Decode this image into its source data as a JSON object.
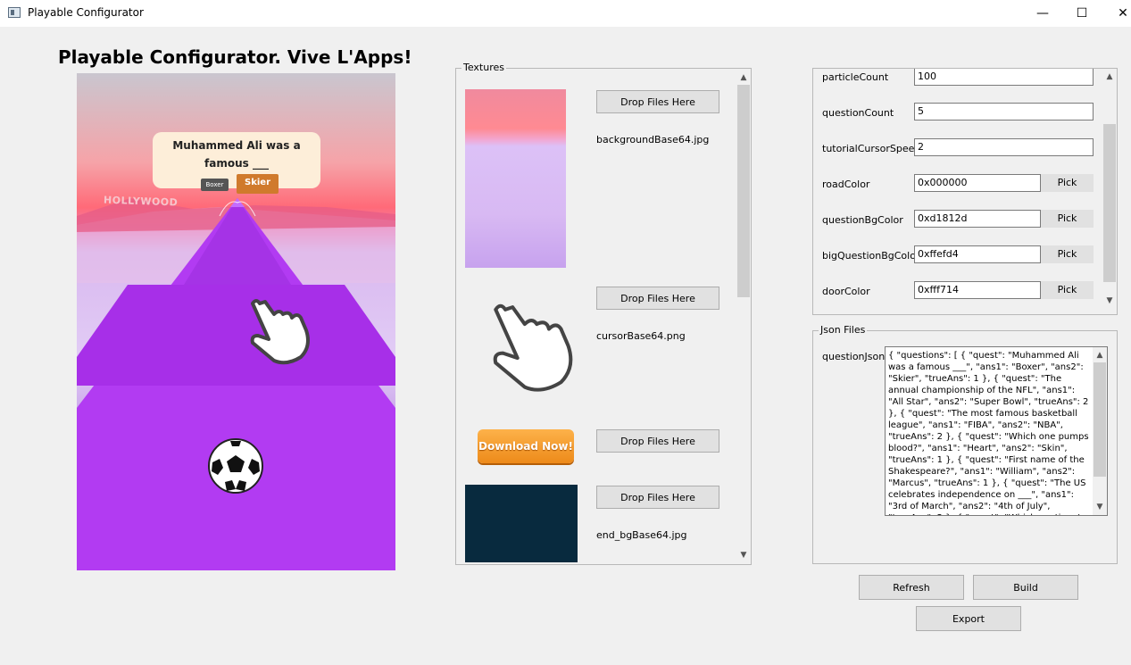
{
  "window": {
    "title": "Playable Configurator",
    "minimize": "—",
    "maximize": "☐",
    "close": "✕"
  },
  "heading": "Playable Configurator. Vive L'Apps!",
  "preview": {
    "question": "Muhammed Ali was a famous ___",
    "ans1": "Boxer",
    "ans2": "Skier",
    "sign": "HOLLYWOOD"
  },
  "textures": {
    "title": "Textures",
    "items": [
      {
        "button": "Drop Files Here",
        "file": "backgroundBase64.jpg"
      },
      {
        "button": "Drop Files Here",
        "file": "cursorBase64.png"
      },
      {
        "button": "Drop Files Here",
        "file": "",
        "thumb_text": "Download Now!"
      },
      {
        "button": "Drop Files Here",
        "file": "end_bgBase64.jpg"
      }
    ]
  },
  "properties": [
    {
      "label": "particleCount",
      "value": "100"
    },
    {
      "label": "questionCount",
      "value": "5"
    },
    {
      "label": "tutorialCursorSpeed",
      "value": "2"
    },
    {
      "label": "roadColor",
      "value": "0x000000",
      "pick": "Pick"
    },
    {
      "label": "questionBgColor",
      "value": "0xd1812d",
      "pick": "Pick"
    },
    {
      "label": "bigQuestionBgColor",
      "value": "0xffefd4",
      "pick": "Pick"
    },
    {
      "label": "doorColor",
      "value": "0xfff714",
      "pick": "Pick"
    }
  ],
  "json_files": {
    "title": "Json Files",
    "label": "questionJson",
    "value": "{ \"questions\": [ { \"quest\": \"Muhammed Ali was a famous ___\", \"ans1\": \"Boxer\", \"ans2\": \"Skier\", \"trueAns\": 1 }, { \"quest\": \"The annual championship of the NFL\", \"ans1\": \"All Star\", \"ans2\": \"Super Bowl\", \"trueAns\": 2 }, { \"quest\": \"The most famous basketball league\", \"ans1\": \"FIBA\", \"ans2\": \"NBA\", \"trueAns\": 2 }, { \"quest\": \"Which one pumps blood?\", \"ans1\": \"Heart\", \"ans2\": \"Skin\", \"trueAns\": 1 }, { \"quest\": \"First name of the Shakespeare?\", \"ans1\": \"William\", \"ans2\": \"Marcus\", \"trueAns\": 1 }, { \"quest\": \"The US celebrates independence on ___\", \"ans1\": \"3rd of March\", \"ans2\": \"4th of July\", \"trueAns\": 2 }, { \"quest\": \"Which continent is the ..."
  },
  "buttons": {
    "refresh": "Refresh",
    "build": "Build",
    "export": "Export"
  },
  "colors": {
    "accent_purple": "#bd4bff",
    "question_bg": "#fdeed9",
    "window_bg": "#f0f0f0"
  }
}
